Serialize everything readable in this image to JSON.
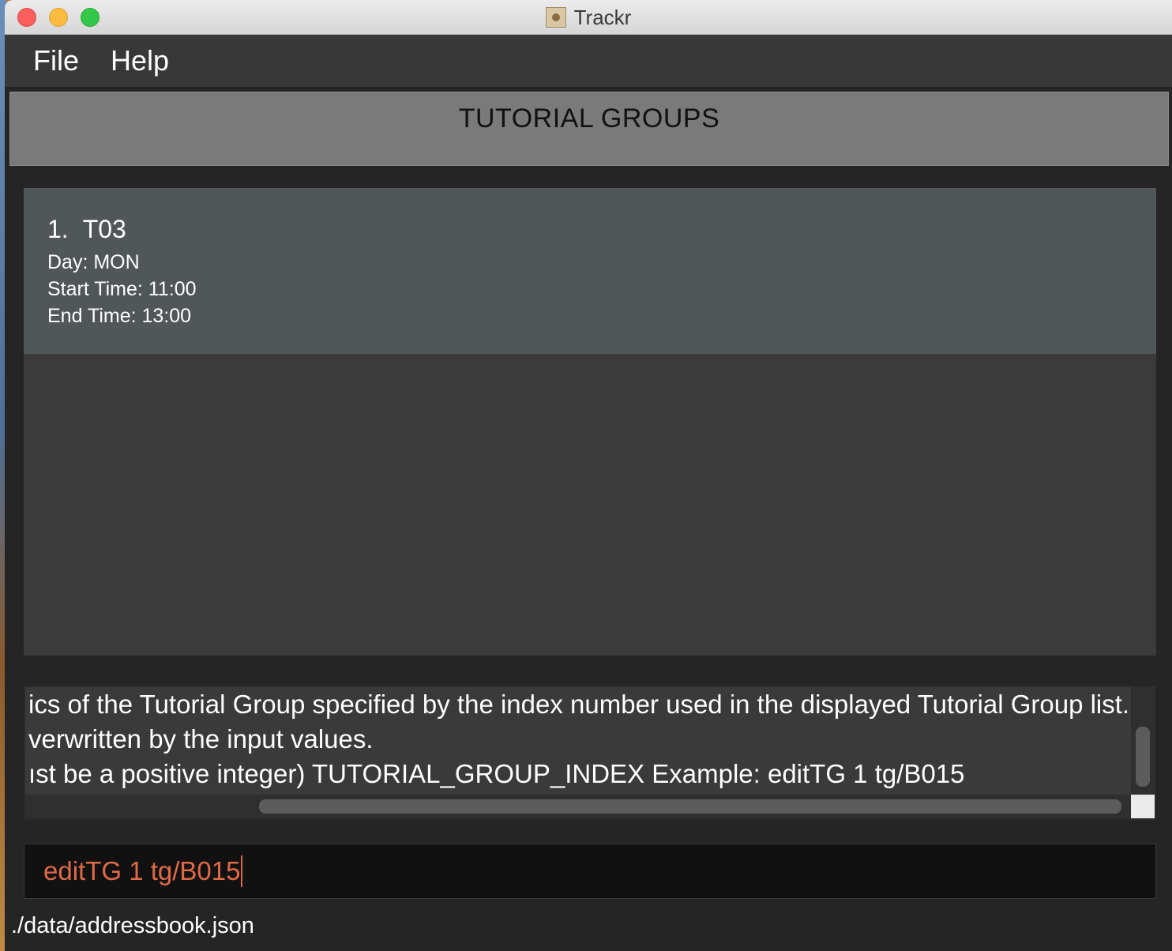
{
  "window": {
    "title": "Trackr",
    "app_icon": "contacts-book-icon"
  },
  "menu": {
    "file": "File",
    "help": "Help"
  },
  "header": {
    "title": "TUTORIAL GROUPS"
  },
  "tutorial_groups": [
    {
      "index": "1.",
      "name": "T03",
      "day": "Day: MON",
      "start_time": "Start Time: 11:00",
      "end_time": "End Time: 13:00"
    }
  ],
  "result_display": {
    "lines": [
      "ics of the Tutorial Group specified by the index number used in the displayed Tutorial Group list.",
      "verwritten by the input values.",
      "ıst be a positive integer) TUTORIAL_GROUP_INDEX Example: editTG 1 tg/B015"
    ]
  },
  "command_box": {
    "value": "editTG 1 tg/B015"
  },
  "status_bar": {
    "path": "./data/addressbook.json"
  },
  "colors": {
    "command_text": "#e06a47",
    "card_background": "#515658",
    "header_background": "#7a7a7a"
  }
}
